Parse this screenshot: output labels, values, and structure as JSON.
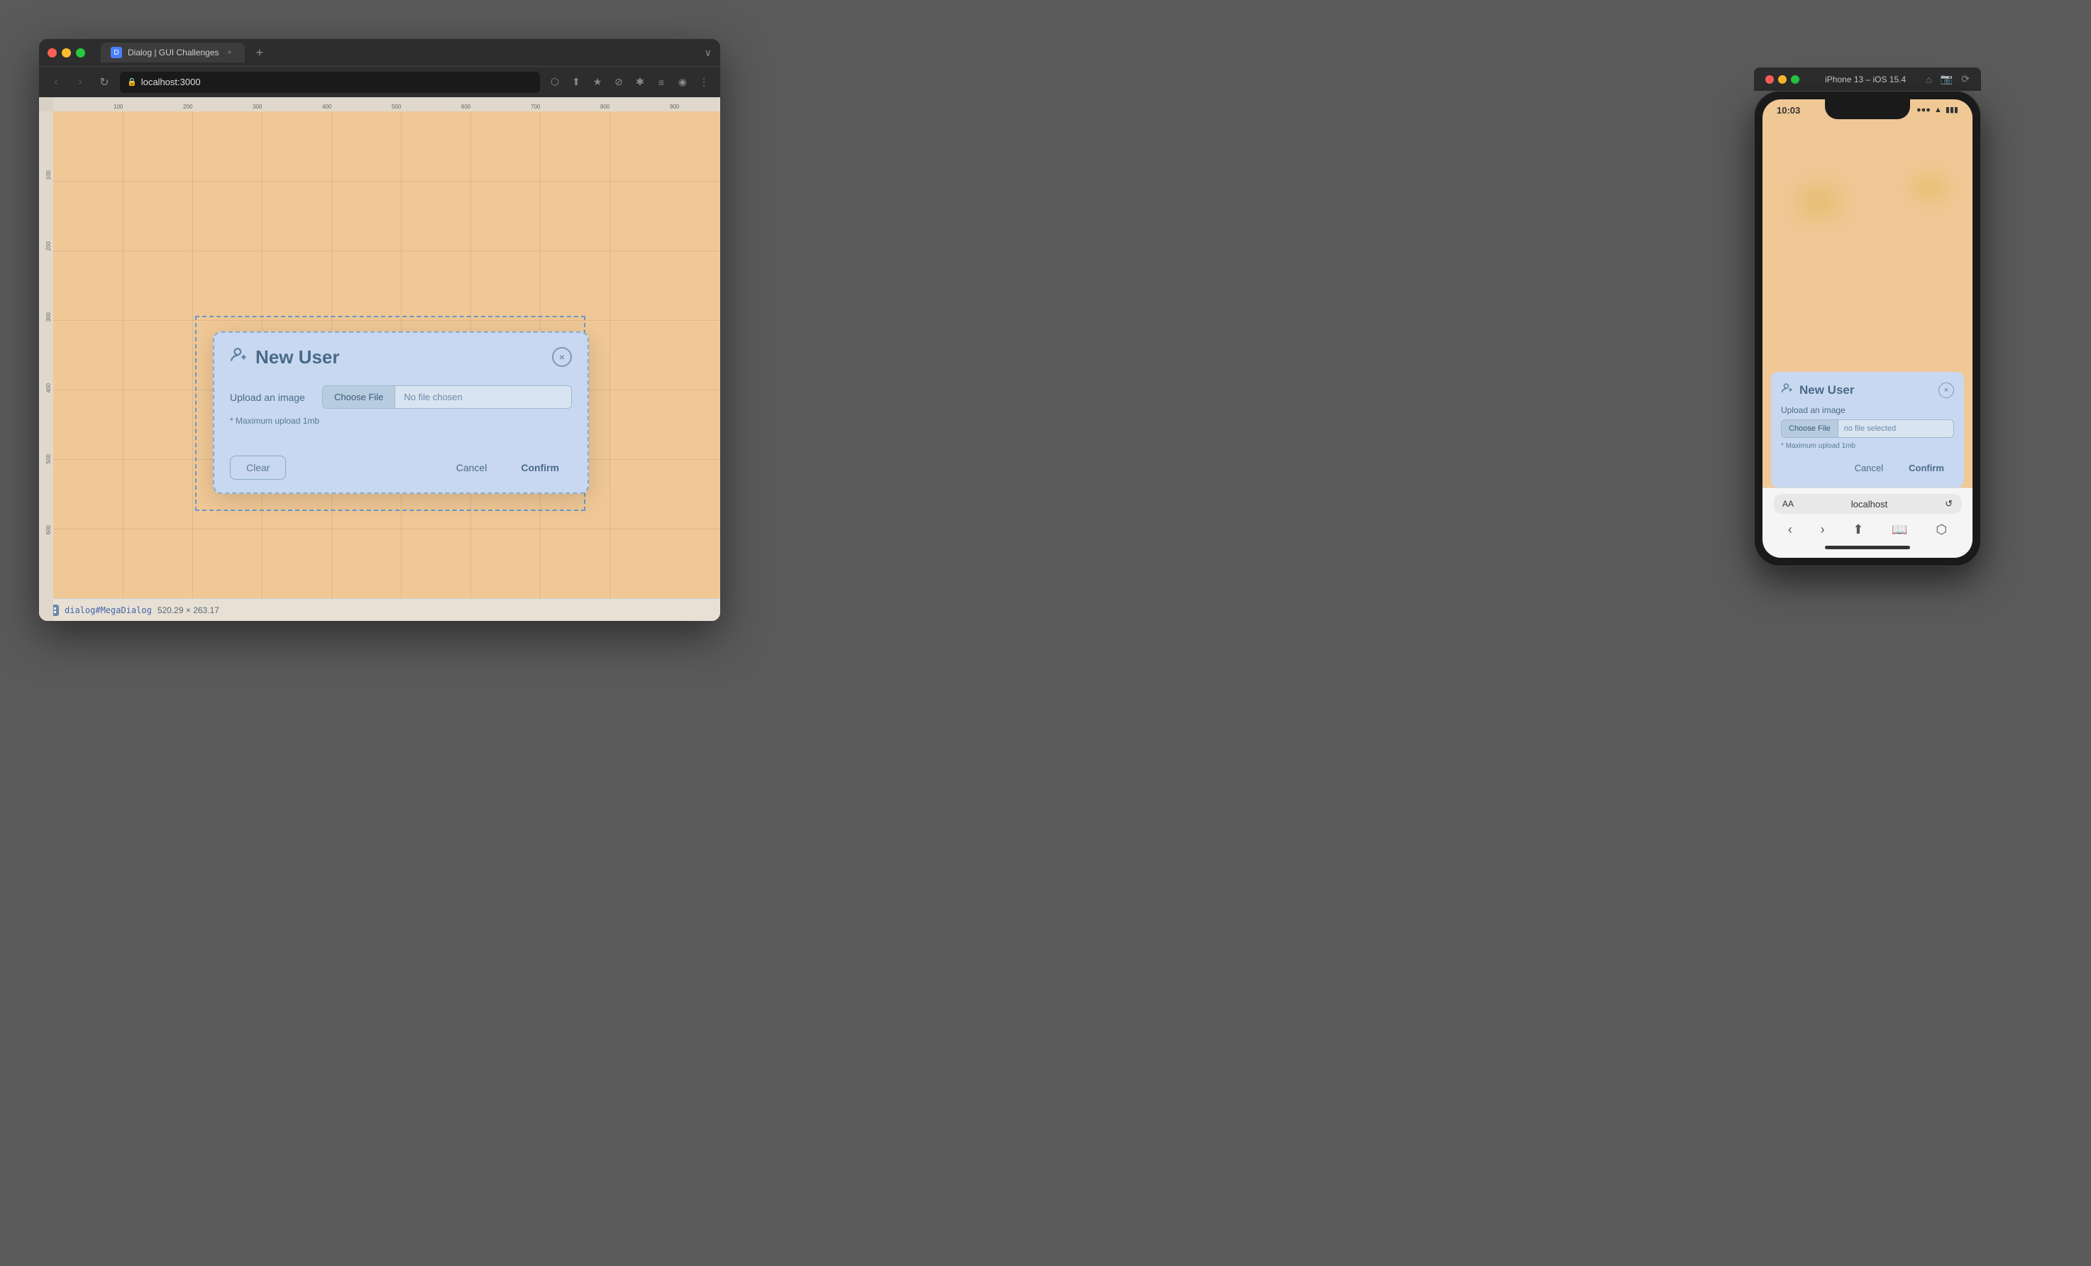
{
  "browser": {
    "tab_title": "Dialog | GUI Challenges",
    "tab_close": "×",
    "tab_add": "+",
    "tab_expand": "∨",
    "nav_back": "‹",
    "nav_forward": "›",
    "nav_refresh": "↺",
    "address": "localhost:3000",
    "toolbar_icons": [
      "⬡",
      "⬆",
      "★",
      "⊘",
      "✱",
      "≡",
      "⊕",
      "⋮"
    ],
    "status_selector": "dialog#MegaDialog",
    "status_dimensions": "520.29 × 263.17"
  },
  "dialog": {
    "title": "New User",
    "close_btn": "×",
    "user_icon": "👤",
    "upload_label": "Upload an image",
    "choose_file_btn": "Choose File",
    "no_file_text": "No file chosen",
    "upload_hint": "* Maximum upload 1mb",
    "clear_btn": "Clear",
    "cancel_btn": "Cancel",
    "confirm_btn": "Confirm"
  },
  "iphone": {
    "device_title": "iPhone 13 – iOS 15.4",
    "time": "10:03",
    "signal": "●●●",
    "wifi": "WiFi",
    "battery": "▮▮▮",
    "dialog": {
      "title": "New User",
      "close_btn": "×",
      "upload_label": "Upload an image",
      "choose_file_btn": "Choose File",
      "no_file_text": "no file selected",
      "upload_hint": "* Maximum upload 1mb",
      "cancel_btn": "Cancel",
      "confirm_btn": "Confirm"
    },
    "url_aa": "AA",
    "url": "localhost",
    "url_reload": "↺",
    "nav_icons": [
      "‹",
      "›",
      "⬆",
      "📖",
      "⬡"
    ]
  },
  "ruler": {
    "marks_h": [
      "100",
      "200",
      "300",
      "400",
      "500",
      "600",
      "700",
      "800",
      "900"
    ],
    "marks_v": [
      "100",
      "200",
      "300",
      "400",
      "500",
      "600"
    ]
  }
}
